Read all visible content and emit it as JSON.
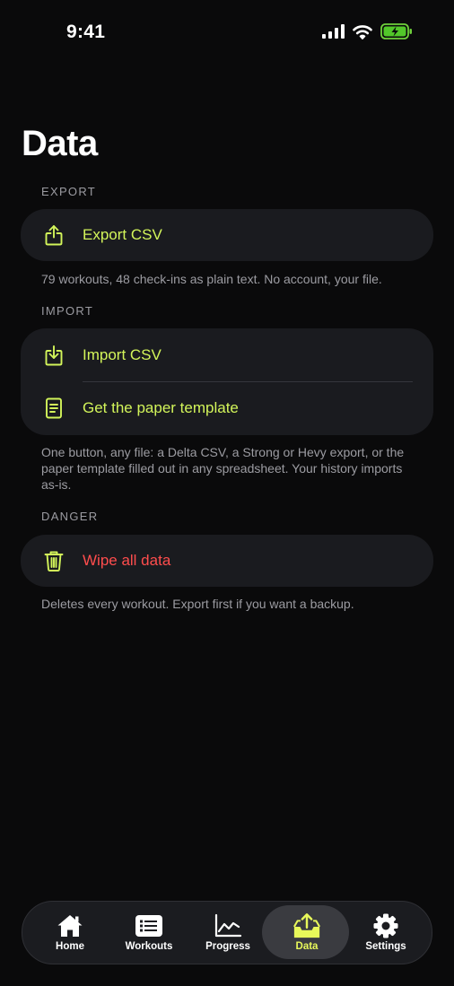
{
  "status_bar": {
    "time": "9:41"
  },
  "page": {
    "title": "Data"
  },
  "sections": {
    "export": {
      "label": "EXPORT",
      "items": [
        {
          "label": "Export CSV",
          "icon": "share-upload-icon"
        }
      ],
      "note": "79 workouts, 48 check-ins as plain text. No account, your file."
    },
    "import": {
      "label": "IMPORT",
      "items": [
        {
          "label": "Import CSV",
          "icon": "download-tray-icon"
        },
        {
          "label": "Get the paper template",
          "icon": "document-icon"
        }
      ],
      "note": "One button, any file: a Delta CSV, a Strong or Hevy export, or the paper template filled out in any spreadsheet. Your history imports as-is."
    },
    "danger": {
      "label": "DANGER",
      "items": [
        {
          "label": "Wipe all data",
          "icon": "trash-icon"
        }
      ],
      "note": "Deletes every workout. Export first if you want a backup."
    }
  },
  "tab_bar": {
    "active": "Data",
    "tabs": [
      {
        "label": "Home",
        "icon": "home-icon"
      },
      {
        "label": "Workouts",
        "icon": "list-icon"
      },
      {
        "label": "Progress",
        "icon": "chart-icon"
      },
      {
        "label": "Data",
        "icon": "tray-upload-icon"
      },
      {
        "label": "Settings",
        "icon": "gear-icon"
      }
    ]
  },
  "colors": {
    "accent": "#d3f55a",
    "tab_active": "#e8f85a",
    "danger": "#ff4d4d",
    "background": "#0a0a0b",
    "card": "#1a1b1f"
  }
}
